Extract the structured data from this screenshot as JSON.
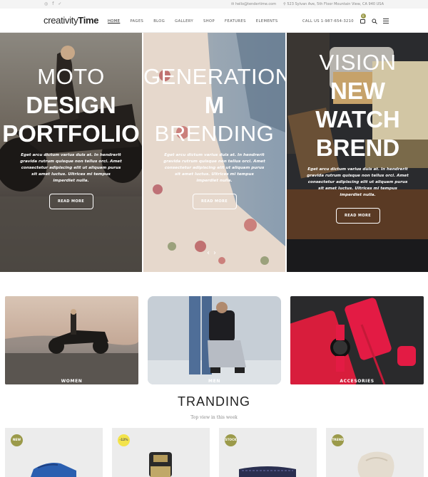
{
  "topbar": {
    "email": "hello@tendertime.com",
    "address": "523 Sylvan Ave, 5th Floor Mountain View, CA 940 USA"
  },
  "header": {
    "logo_light": "creativity",
    "logo_bold": "Time",
    "nav": [
      "HOME",
      "PAGES",
      "BLOG",
      "GALLERY",
      "SHOP",
      "FEATURES",
      "ELEMENTS"
    ],
    "call": "CALL US 1-987-654-3210",
    "cart_count": "0"
  },
  "hero": [
    {
      "line1": "MOTO",
      "line2": "DESIGN",
      "line3": "PORTFOLIO",
      "text": "Eget arcu dictum varius duis at. In hendrerit gravida rutrum quisque non tellus orci. Amet consectetur adipiscing elit ut aliquam purus sit amet luctus. Ultrices mi tempus imperdiet nulla.",
      "button": "READ MORE"
    },
    {
      "line1": "GENERATION",
      "line2": "M",
      "line3": "BRENDING",
      "text": "Eget arcu dictum varius duis at. In hendrerit gravida rutrum quisque non tellus orci. Amet consectetur adipiscing elit ut aliquam purus sit amet luctus. Ultrices mi tempus imperdiet nulla.",
      "button": "READ MORE"
    },
    {
      "line1": "VISION",
      "line2": "NEW",
      "line3": "WATCH",
      "line4": "BREND",
      "text": "Eget arcu dictum varius duis at. In hendrerit gravida rutrum quisque non tellus orci. Amet consectetur adipiscing elit ut aliquam purus sit amet luctus. Ultrices mi tempus imperdiet nulla.",
      "button": "READ MORE"
    }
  ],
  "slider_arrows": {
    "prev": "‹",
    "next": "›"
  },
  "categories": [
    "WOMEN",
    "MEN",
    "ACCESORIES"
  ],
  "trending": {
    "title": "TRANDING",
    "subtitle": "Top view in this week"
  },
  "products": [
    {
      "tag": "NEW"
    },
    {
      "tag": "-12%"
    },
    {
      "tag": "STOCK"
    },
    {
      "tag": "TREND"
    }
  ],
  "colors": {
    "accent": "#9b9a4a",
    "sale_badge": "#f3e34a"
  }
}
